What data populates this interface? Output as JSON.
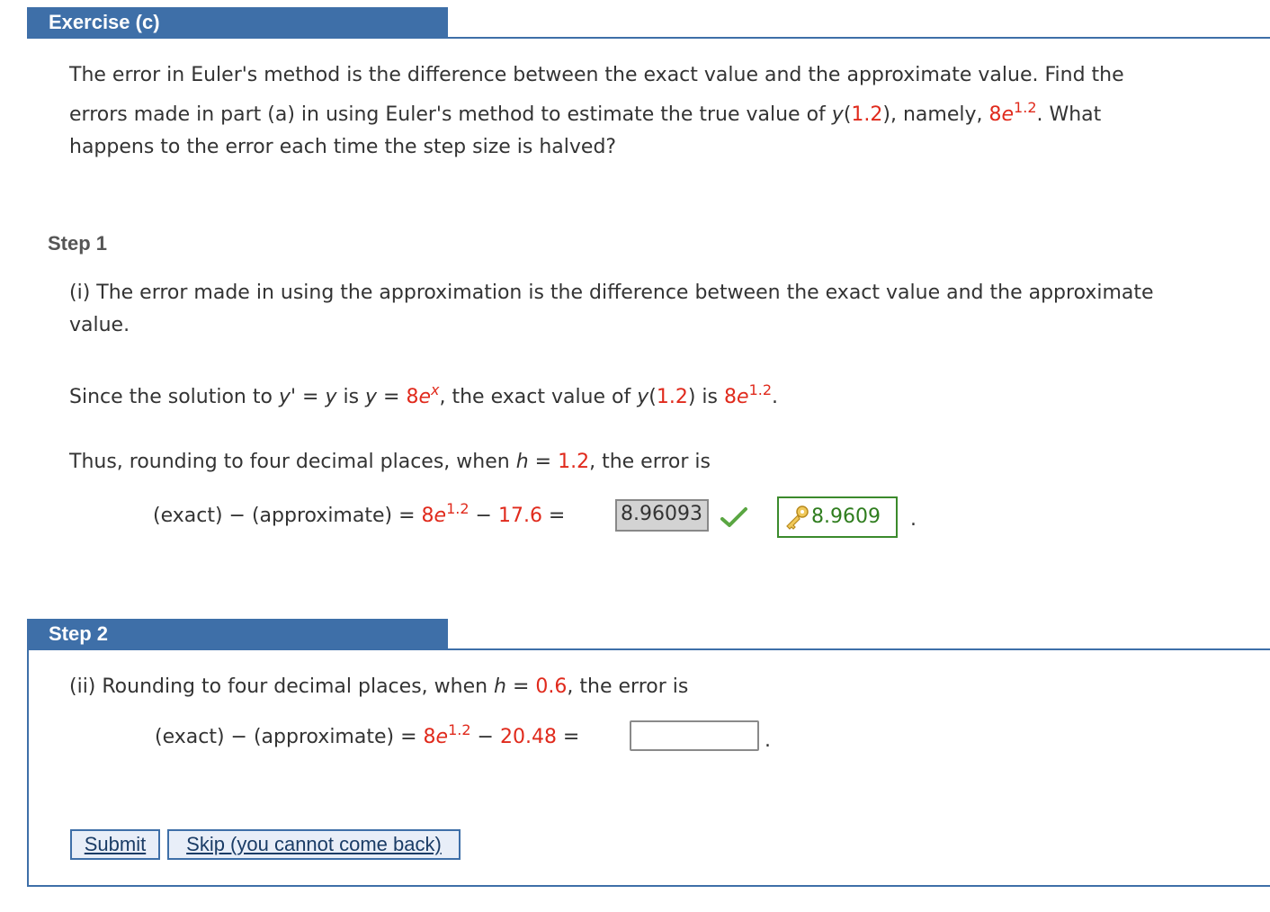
{
  "exercise": {
    "title": "Exercise (c)",
    "problem_line1": "The error in Euler's method is the difference between the exact value and the approximate value. Find the",
    "problem_line2_a": "errors made in part (a) in using Euler's method to estimate the true value of ",
    "problem_y": "y",
    "problem_arg": "1.2",
    "problem_namely": "), namely, ",
    "problem_coef": "8",
    "problem_e": "e",
    "problem_exp": "1.2",
    "problem_what": ". What",
    "problem_line3": "happens to the error each time the step size is halved?"
  },
  "step1": {
    "label": "Step 1",
    "intro_line1": "(i) The error made in using the approximation is the difference between the exact value and the approximate",
    "intro_line2": "value.",
    "since_prefix": "Since the solution to ",
    "y_prime": "y'",
    "eq": " = ",
    "y": "y",
    "is_text": " is ",
    "coef": "8",
    "e": "e",
    "x_exp": "x",
    "exact_text": ", the exact value of ",
    "arg": "1.2",
    "is_text2": ") is ",
    "exp": "1.2",
    "thus_prefix": "Thus, rounding to four decimal places, when ",
    "h": "h",
    "h_value": "1.2",
    "thus_suffix": ", the error is",
    "formula_left": "(exact) − (approximate)",
    "approx_value": "17.6",
    "answer_value": "8.96093",
    "correct_value": "8.9609",
    "period": "."
  },
  "step2": {
    "label": "Step 2",
    "line_prefix": "(ii) Rounding to four decimal places, when ",
    "h": "h",
    "h_value": "0.6",
    "line_suffix": ", the error is",
    "formula_left": "(exact) − (approximate)",
    "coef": "8",
    "e": "e",
    "exp": "1.2",
    "approx_value": "20.48",
    "input_value": "",
    "period": ".",
    "submit_label": "Submit",
    "skip_label": "Skip (you cannot come back)"
  },
  "colors": {
    "accent": "#3e6fa8",
    "given_value": "#e02a1c",
    "correct": "#2f7d1e",
    "check": "#5aa642"
  },
  "icons": {
    "check": "checkmark-icon",
    "key": "key-icon"
  }
}
